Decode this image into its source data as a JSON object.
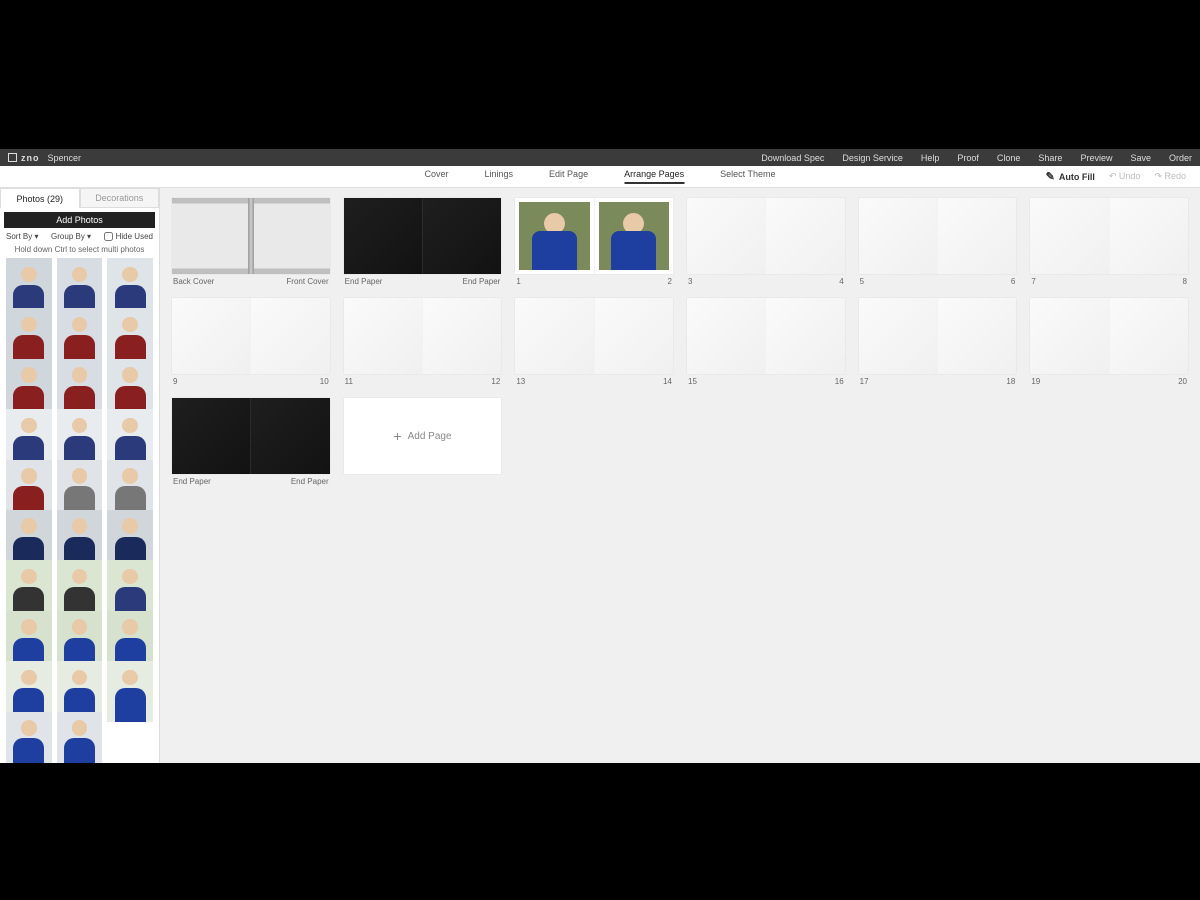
{
  "header": {
    "brand": "zno",
    "project": "Spencer",
    "menu": [
      "Download Spec",
      "Design Service",
      "Help",
      "Proof",
      "Clone",
      "Share",
      "Preview",
      "Save",
      "Order"
    ],
    "badge_on": "Design Service"
  },
  "nav": {
    "tabs": [
      "Cover",
      "Linings",
      "Edit Page",
      "Arrange Pages",
      "Select Theme"
    ],
    "active": "Arrange Pages",
    "actions": {
      "autofill": "Auto Fill",
      "undo": "Undo",
      "redo": "Redo"
    }
  },
  "sidebar": {
    "tabs": {
      "photos": "Photos (29)",
      "decorations": "Decorations"
    },
    "add_photos": "Add Photos",
    "sort_by": "Sort By",
    "group_by": "Group By",
    "hide_used": "Hide Used",
    "hint": "Hold down Ctrl to select multi photos",
    "thumbs": [
      {
        "bg": "#cfd6dc",
        "shirt": "#2a3a7a"
      },
      {
        "bg": "#d7dde2",
        "shirt": "#2a3a7a"
      },
      {
        "bg": "#dfe4e8",
        "shirt": "#2a3a7a"
      },
      {
        "bg": "#cfd6dc",
        "shirt": "#8a1f1f"
      },
      {
        "bg": "#d7dde2",
        "shirt": "#8a1f1f"
      },
      {
        "bg": "#dfe4e8",
        "shirt": "#8a1f1f"
      },
      {
        "bg": "#cfd6dc",
        "shirt": "#8a1f1f"
      },
      {
        "bg": "#d7dde2",
        "shirt": "#8a1f1f"
      },
      {
        "bg": "#dfe4e8",
        "shirt": "#8a1f1f"
      },
      {
        "bg": "#e8ecef",
        "shirt": "#2a3a7a"
      },
      {
        "bg": "#e8ecef",
        "shirt": "#2a3a7a"
      },
      {
        "bg": "#e8ecef",
        "shirt": "#2a3a7a"
      },
      {
        "bg": "#e0e4e8",
        "shirt": "#8a1f1f"
      },
      {
        "bg": "#e0e4e8",
        "shirt": "#777"
      },
      {
        "bg": "#e0e4e8",
        "shirt": "#777"
      },
      {
        "bg": "#d0d6da",
        "shirt": "#1a2a5a"
      },
      {
        "bg": "#d0d6da",
        "shirt": "#1a2a5a"
      },
      {
        "bg": "#d0d6da",
        "shirt": "#1a2a5a"
      },
      {
        "bg": "#dbe6d2",
        "shirt": "#333"
      },
      {
        "bg": "#dbe6d2",
        "shirt": "#333"
      },
      {
        "bg": "#dbe6d2",
        "shirt": "#2a3a7a"
      },
      {
        "bg": "#d6e2cd",
        "shirt": "#1e3fa0"
      },
      {
        "bg": "#d6e2cd",
        "shirt": "#1e3fa0"
      },
      {
        "bg": "#d6e2cd",
        "shirt": "#1e3fa0"
      },
      {
        "bg": "#e6ece2",
        "shirt": "#1e3fa0"
      },
      {
        "bg": "#e6ece2",
        "shirt": "#1e3fa0"
      },
      {
        "bg": "#e6ece2",
        "shirt": "#1e3fa0"
      },
      {
        "bg": "#e0e4e8",
        "shirt": "#1e3fa0"
      },
      {
        "bg": "#e0e4e8",
        "shirt": "#1e3fa0"
      }
    ]
  },
  "spreads": [
    {
      "type": "cover",
      "left_label": "Back Cover",
      "right_label": "Front Cover"
    },
    {
      "type": "dark",
      "left_label": "End Paper",
      "right_label": "End Paper"
    },
    {
      "type": "photo",
      "left_label": "1",
      "right_label": "2",
      "left_img": {
        "bg": "#7a8a5a",
        "shirt": "#1e3fa0"
      },
      "right_img": {
        "bg": "#7a8a5a",
        "shirt": "#1e3fa0"
      }
    },
    {
      "type": "blank",
      "left_label": "3",
      "right_label": "4"
    },
    {
      "type": "blank",
      "left_label": "5",
      "right_label": "6"
    },
    {
      "type": "blank",
      "left_label": "7",
      "right_label": "8"
    },
    {
      "type": "blank",
      "left_label": "9",
      "right_label": "10"
    },
    {
      "type": "blank",
      "left_label": "11",
      "right_label": "12"
    },
    {
      "type": "blank",
      "left_label": "13",
      "right_label": "14"
    },
    {
      "type": "blank",
      "left_label": "15",
      "right_label": "16"
    },
    {
      "type": "blank",
      "left_label": "17",
      "right_label": "18"
    },
    {
      "type": "blank",
      "left_label": "19",
      "right_label": "20"
    },
    {
      "type": "dark",
      "left_label": "End Paper",
      "right_label": "End Paper"
    },
    {
      "type": "addpage",
      "label": "Add Page"
    }
  ]
}
